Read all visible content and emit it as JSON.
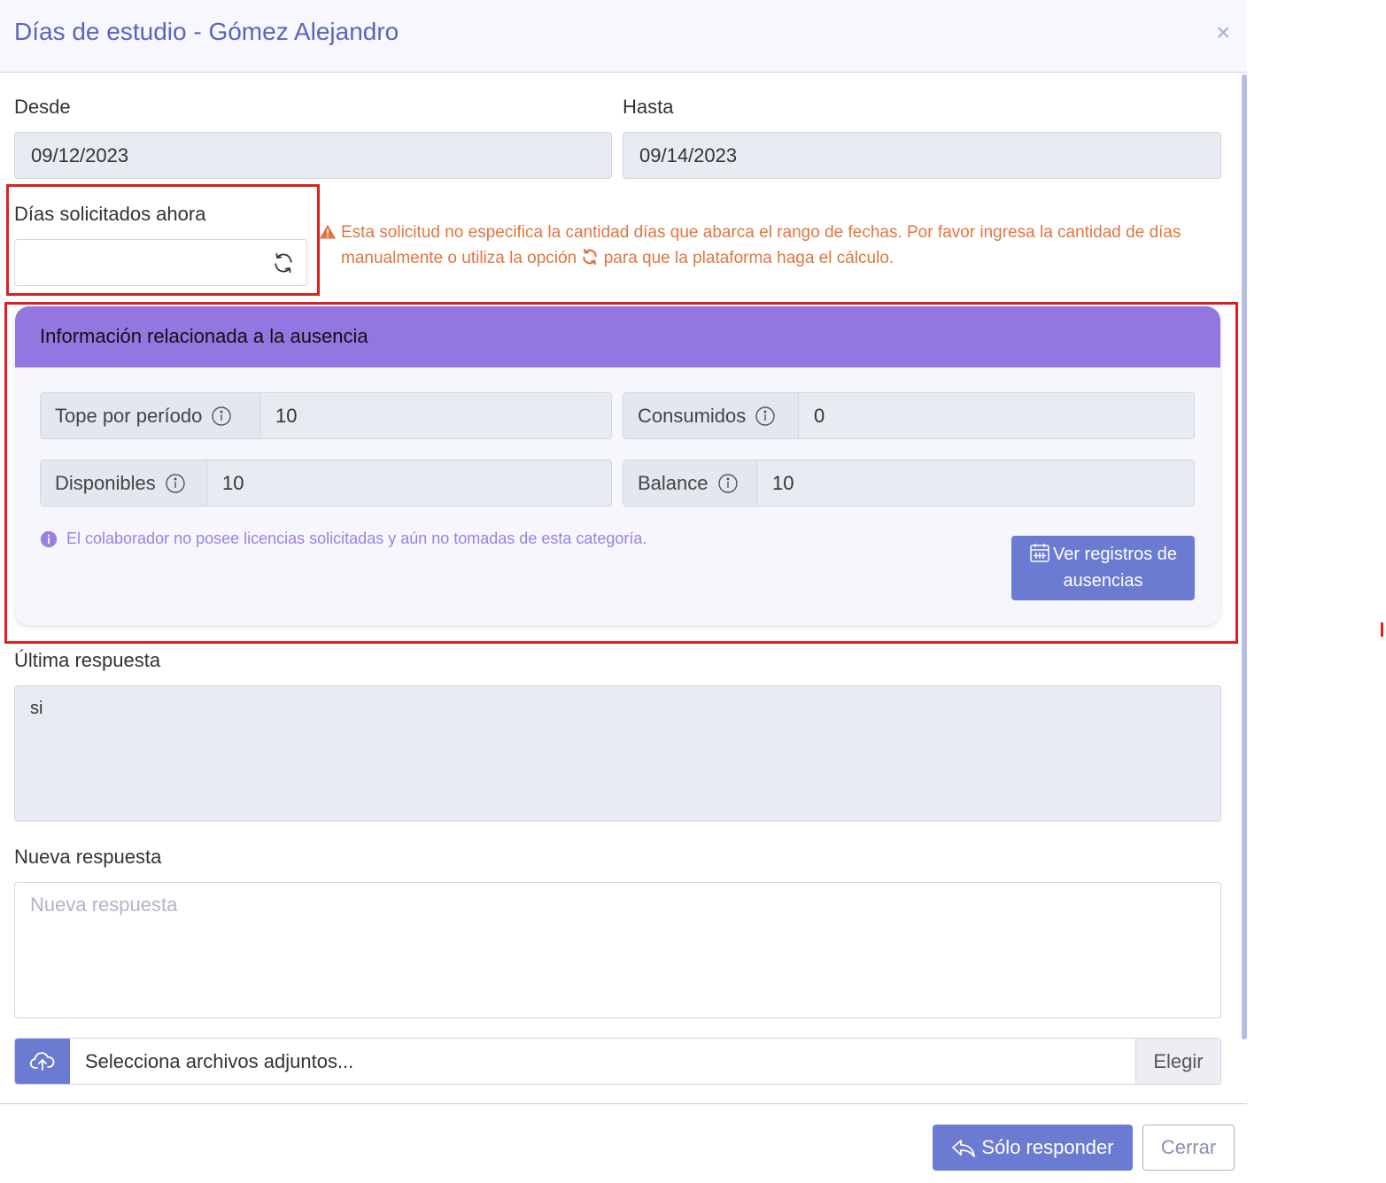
{
  "modal": {
    "title": "Días de estudio - Gómez Alejandro",
    "close_label": "×"
  },
  "dates": {
    "from_label": "Desde",
    "from_value": "09/12/2023",
    "to_label": "Hasta",
    "to_value": "09/14/2023"
  },
  "days_requested": {
    "label": "Días solicitados ahora",
    "value": ""
  },
  "warning": {
    "text_part1": "Esta solicitud no especifica la cantidad días que abarca el rango de fechas. Por favor ingresa la cantidad de días manualmente o utiliza la opción",
    "text_part2": "para que la plataforma haga el cálculo.",
    "color": "#e2753f"
  },
  "absence_info": {
    "title": "Información relacionada a la ausencia",
    "header_color": "#9376e0",
    "stats": [
      {
        "label": "Tope por período",
        "value": "10"
      },
      {
        "label": "Consumidos",
        "value": "0"
      },
      {
        "label": "Disponibles",
        "value": "10"
      },
      {
        "label": "Balance",
        "value": "10"
      }
    ],
    "note": "El colaborador no posee licencias solicitadas y aún no tomadas de esta categoría.",
    "view_records_button": "Ver registros de ausencias"
  },
  "last_response": {
    "label": "Última respuesta",
    "value": "si"
  },
  "new_response": {
    "label": "Nueva respuesta",
    "placeholder": "Nueva respuesta"
  },
  "attachments": {
    "placeholder": "Selecciona archivos adjuntos...",
    "choose_label": "Elegir"
  },
  "footer": {
    "reply_button": "Sólo responder",
    "close_button": "Cerrar"
  },
  "colors": {
    "accent": "#6b7bd1",
    "title": "#5b63c2",
    "highlight": "#e01e1e"
  }
}
